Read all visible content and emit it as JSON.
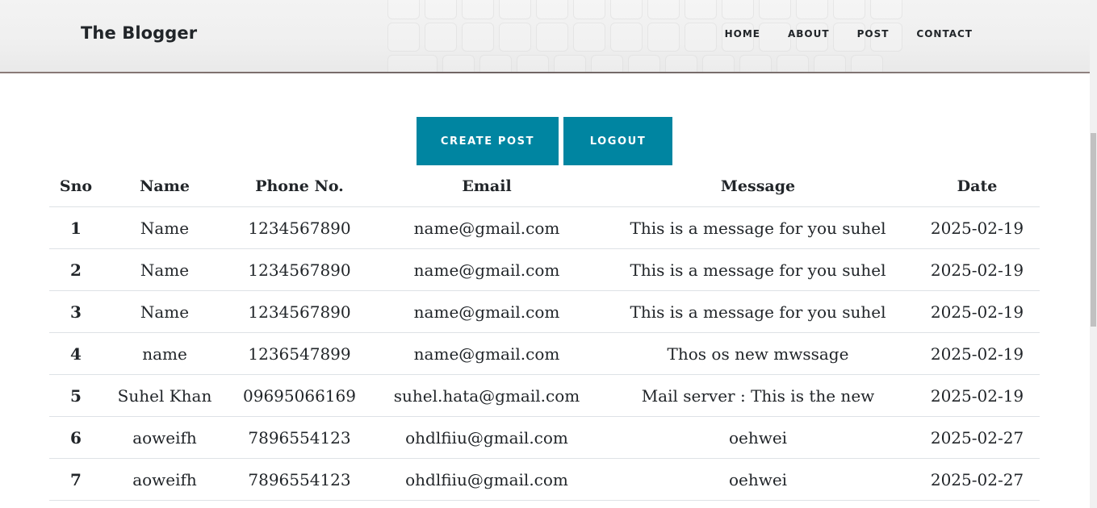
{
  "header": {
    "brand": "The Blogger",
    "nav": [
      "HOME",
      "ABOUT",
      "POST",
      "CONTACT"
    ]
  },
  "actions": {
    "create_post": "CREATE POST",
    "logout": "LOGOUT"
  },
  "colors": {
    "button_bg": "#0085a1",
    "button_text": "#ffffff",
    "text": "#212529",
    "row_border": "#dee2e6"
  },
  "table": {
    "headers": [
      "Sno",
      "Name",
      "Phone No.",
      "Email",
      "Message",
      "Date"
    ],
    "rows": [
      [
        "1",
        "Name",
        "1234567890",
        "name@gmail.com",
        "This is a message for you suhel",
        "2025-02-19"
      ],
      [
        "2",
        "Name",
        "1234567890",
        "name@gmail.com",
        "This is a message for you suhel",
        "2025-02-19"
      ],
      [
        "3",
        "Name",
        "1234567890",
        "name@gmail.com",
        "This is a message for you suhel",
        "2025-02-19"
      ],
      [
        "4",
        "name",
        "1236547899",
        "name@gmail.com",
        "Thos os new mwssage",
        "2025-02-19"
      ],
      [
        "5",
        "Suhel Khan",
        "09695066169",
        "suhel.hata@gmail.com",
        "Mail server : This is the new",
        "2025-02-19"
      ],
      [
        "6",
        "aoweifh",
        "7896554123",
        "ohdlfiiu@gmail.com",
        "oehwei",
        "2025-02-27"
      ],
      [
        "7",
        "aoweifh",
        "7896554123",
        "ohdlfiiu@gmail.com",
        "oehwei",
        "2025-02-27"
      ]
    ]
  }
}
